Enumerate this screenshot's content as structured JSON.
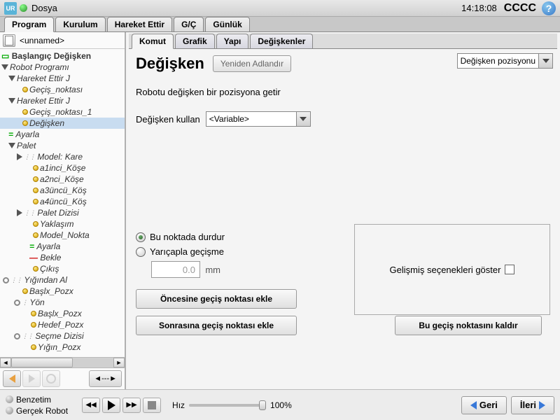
{
  "titlebar": {
    "title": "Dosya",
    "time": "14:18:08",
    "status": "CCCC",
    "logo": "UR"
  },
  "mainTabs": [
    "Program",
    "Kurulum",
    "Hareket Ettir",
    "G/Ç",
    "Günlük"
  ],
  "filename": "<unnamed>",
  "tree": {
    "header": "Başlangıç Değişken",
    "root": "Robot Programı",
    "items": [
      "Hareket Ettir J",
      "Geçiş_noktası",
      "Hareket Ettir J",
      "Geçiş_noktası_1",
      "Değişken",
      "Ayarla",
      "Palet",
      "Model: Kare",
      "a1inci_Köşe",
      "a2nci_Köşe",
      "a3üncü_Köş",
      "a4üncü_Köş",
      "Palet Dizisi",
      "Yaklaşım",
      "Model_Nokta",
      "Ayarla",
      "Bekle",
      "Çıkış",
      "Yığından Al",
      "Başlx_Pozx",
      "Yön",
      "Başlx_Pozx",
      "Hedef_Pozx",
      "Seçme Dizisi",
      "Yığın_Pozx"
    ]
  },
  "subTabs": [
    "Komut",
    "Grafik",
    "Yapı",
    "Değişkenler"
  ],
  "panel": {
    "title": "Değişken",
    "rename": "Yeniden Adlandır",
    "posSelect": "Değişken pozisyonu",
    "desc": "Robotu değişken bir pozisyona getir",
    "useVarLabel": "Değişken kullan",
    "useVarValue": "<Variable>",
    "advanced": "Gelişmiş seçenekleri göster",
    "radio1": "Bu noktada durdur",
    "radio2": "Yarıçapla geçişme",
    "radiusValue": "0.0",
    "radiusUnit": "mm",
    "btnBefore": "Öncesine geçiş noktası ekle",
    "btnAfter": "Sonrasına geçiş noktası ekle",
    "btnRemove": "Bu geçiş noktasını kaldır"
  },
  "nav": {
    "slider": "◄---►"
  },
  "footer": {
    "sim": "Benzetim",
    "real": "Gerçek Robot",
    "speedLabel": "Hız",
    "speedValue": "100%",
    "back": "Geri",
    "next": "İleri"
  }
}
